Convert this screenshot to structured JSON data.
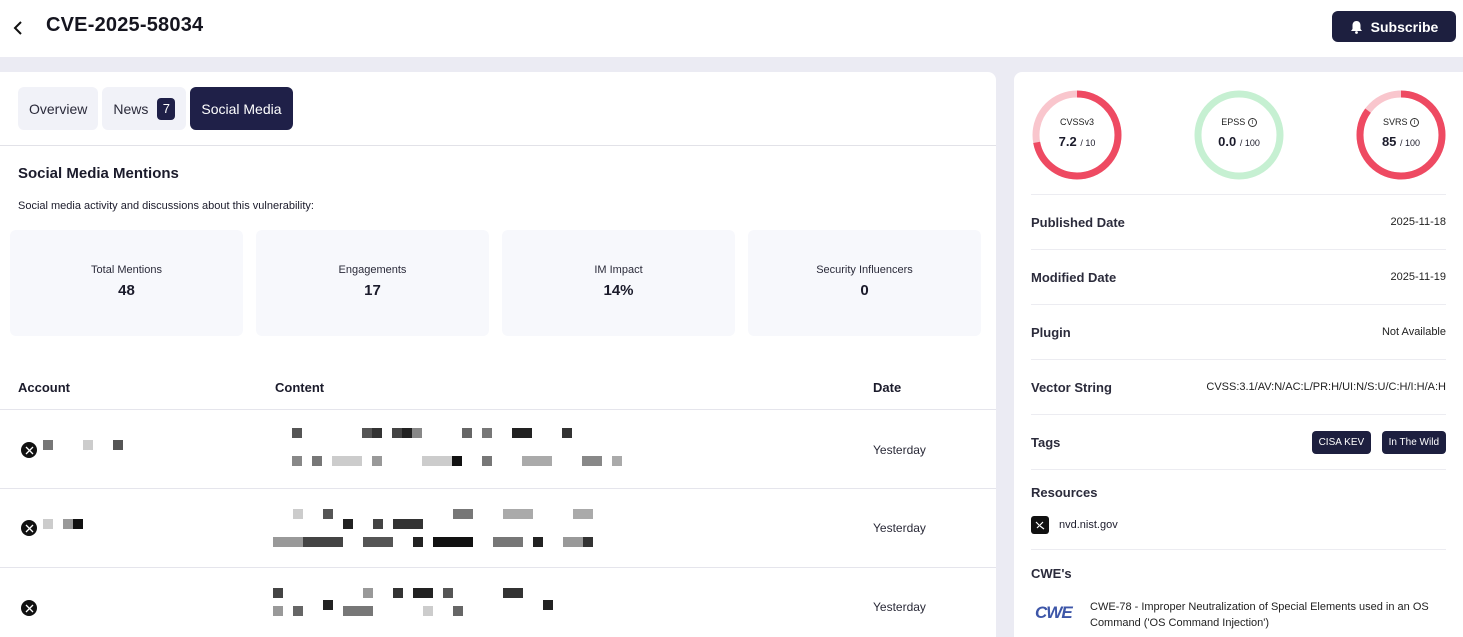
{
  "header": {
    "title": "CVE-2025-58034",
    "subscribe_label": "Subscribe"
  },
  "tabs": [
    {
      "label": "Overview"
    },
    {
      "label": "News",
      "badge": "7"
    },
    {
      "label": "Social Media",
      "active": true
    }
  ],
  "social": {
    "title": "Social Media Mentions",
    "description": "Social media activity and discussions about this vulnerability:",
    "stats": [
      {
        "label": "Total Mentions",
        "value": "48"
      },
      {
        "label": "Engagements",
        "value": "17"
      },
      {
        "label": "IM Impact",
        "value": "14%"
      },
      {
        "label": "Security Influencers",
        "value": "0"
      }
    ],
    "columns": {
      "account": "Account",
      "content": "Content",
      "date": "Date"
    },
    "rows": [
      {
        "date": "Yesterday"
      },
      {
        "date": "Yesterday"
      },
      {
        "date": "Yesterday"
      }
    ]
  },
  "scores": [
    {
      "label": "CVSSv3",
      "value": "7.2",
      "max": "/ 10",
      "fraction": 0.72,
      "color": "#ee4a62",
      "track": "#f9c6cd"
    },
    {
      "label": "EPSS",
      "value": "0.0",
      "max": "/ 100",
      "fraction": 0.0,
      "color": "#ee4a62",
      "track": "#c6f0d2"
    },
    {
      "label": "SVRS",
      "value": "85",
      "max": "/ 100",
      "fraction": 0.85,
      "color": "#ee4a62",
      "track": "#f9c6cd"
    }
  ],
  "details": {
    "published_label": "Published Date",
    "published_value": "2025-11-18",
    "modified_label": "Modified Date",
    "modified_value": "2025-11-19",
    "plugin_label": "Plugin",
    "plugin_value": "Not Available",
    "vector_label": "Vector String",
    "vector_value": "CVSS:3.1/AV:N/AC:L/PR:H/UI:N/S:U/C:H/I:H/A:H",
    "tags_label": "Tags",
    "tags": [
      "CISA KEV",
      "In The Wild"
    ]
  },
  "resources": {
    "title": "Resources",
    "link": "nvd.nist.gov"
  },
  "cwe": {
    "title": "CWE's",
    "logo_text": "CWE",
    "text": "CWE-78 - Improper Neutralization of Special Elements used in an OS Command ('OS Command Injection')"
  }
}
